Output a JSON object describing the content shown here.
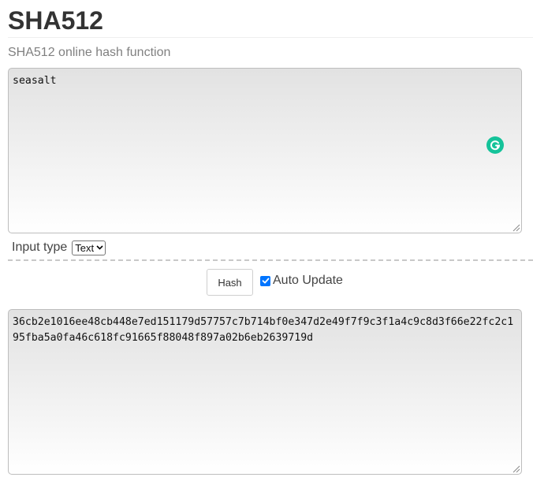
{
  "header": {
    "title": "SHA512",
    "subtitle": "SHA512 online hash function"
  },
  "input": {
    "value": "seasalt"
  },
  "options": {
    "input_type_label": "Input type",
    "input_type_selected": "Text"
  },
  "actions": {
    "hash_label": "Hash",
    "auto_update_label": "Auto Update",
    "auto_update_checked": true
  },
  "output": {
    "value": "36cb2e1016ee48cb448e7ed151179d57757c7b714bf0e347d2e49f7f9c3f1a4c9c8d3f66e22fc2c195fba5a0fa46c618fc91665f88048f897a02b6eb2639719d"
  },
  "colors": {
    "grammarly_badge": "#15c39a",
    "checkbox_accent": "#0075ff"
  }
}
